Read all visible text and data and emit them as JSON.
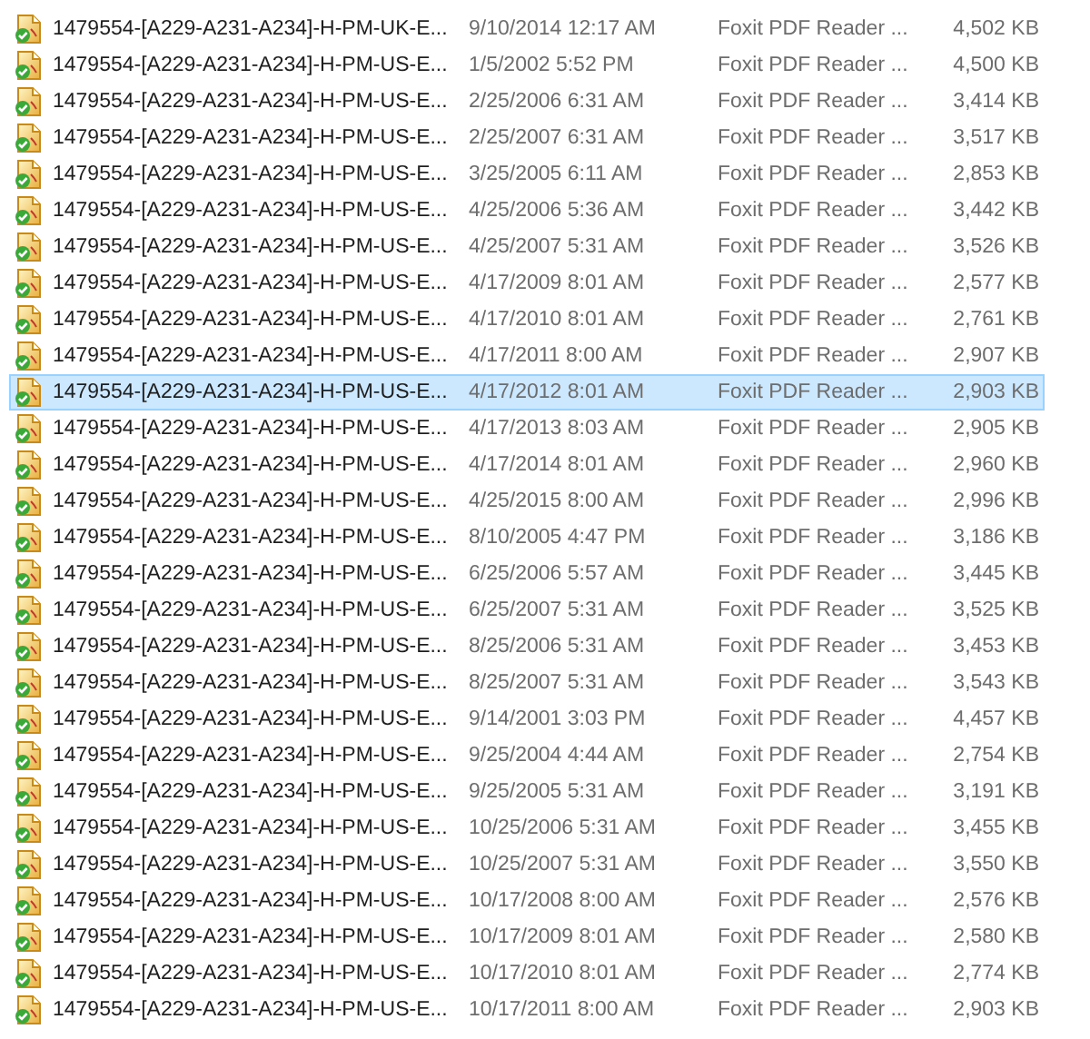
{
  "files": [
    {
      "name": "1479554-[A229-A231-A234]-H-PM-UK-E...",
      "modified": "9/10/2014 12:17 AM",
      "type": "Foxit PDF Reader ...",
      "size": "4,502 KB",
      "selected": false
    },
    {
      "name": "1479554-[A229-A231-A234]-H-PM-US-E...",
      "modified": "1/5/2002 5:52 PM",
      "type": "Foxit PDF Reader ...",
      "size": "4,500 KB",
      "selected": false
    },
    {
      "name": "1479554-[A229-A231-A234]-H-PM-US-E...",
      "modified": "2/25/2006 6:31 AM",
      "type": "Foxit PDF Reader ...",
      "size": "3,414 KB",
      "selected": false
    },
    {
      "name": "1479554-[A229-A231-A234]-H-PM-US-E...",
      "modified": "2/25/2007 6:31 AM",
      "type": "Foxit PDF Reader ...",
      "size": "3,517 KB",
      "selected": false
    },
    {
      "name": "1479554-[A229-A231-A234]-H-PM-US-E...",
      "modified": "3/25/2005 6:11 AM",
      "type": "Foxit PDF Reader ...",
      "size": "2,853 KB",
      "selected": false
    },
    {
      "name": "1479554-[A229-A231-A234]-H-PM-US-E...",
      "modified": "4/25/2006 5:36 AM",
      "type": "Foxit PDF Reader ...",
      "size": "3,442 KB",
      "selected": false
    },
    {
      "name": "1479554-[A229-A231-A234]-H-PM-US-E...",
      "modified": "4/25/2007 5:31 AM",
      "type": "Foxit PDF Reader ...",
      "size": "3,526 KB",
      "selected": false
    },
    {
      "name": "1479554-[A229-A231-A234]-H-PM-US-E...",
      "modified": "4/17/2009 8:01 AM",
      "type": "Foxit PDF Reader ...",
      "size": "2,577 KB",
      "selected": false
    },
    {
      "name": "1479554-[A229-A231-A234]-H-PM-US-E...",
      "modified": "4/17/2010 8:01 AM",
      "type": "Foxit PDF Reader ...",
      "size": "2,761 KB",
      "selected": false
    },
    {
      "name": "1479554-[A229-A231-A234]-H-PM-US-E...",
      "modified": "4/17/2011 8:00 AM",
      "type": "Foxit PDF Reader ...",
      "size": "2,907 KB",
      "selected": false
    },
    {
      "name": "1479554-[A229-A231-A234]-H-PM-US-E...",
      "modified": "4/17/2012 8:01 AM",
      "type": "Foxit PDF Reader ...",
      "size": "2,903 KB",
      "selected": true
    },
    {
      "name": "1479554-[A229-A231-A234]-H-PM-US-E...",
      "modified": "4/17/2013 8:03 AM",
      "type": "Foxit PDF Reader ...",
      "size": "2,905 KB",
      "selected": false
    },
    {
      "name": "1479554-[A229-A231-A234]-H-PM-US-E...",
      "modified": "4/17/2014 8:01 AM",
      "type": "Foxit PDF Reader ...",
      "size": "2,960 KB",
      "selected": false
    },
    {
      "name": "1479554-[A229-A231-A234]-H-PM-US-E...",
      "modified": "4/25/2015 8:00 AM",
      "type": "Foxit PDF Reader ...",
      "size": "2,996 KB",
      "selected": false
    },
    {
      "name": "1479554-[A229-A231-A234]-H-PM-US-E...",
      "modified": "8/10/2005 4:47 PM",
      "type": "Foxit PDF Reader ...",
      "size": "3,186 KB",
      "selected": false
    },
    {
      "name": "1479554-[A229-A231-A234]-H-PM-US-E...",
      "modified": "6/25/2006 5:57 AM",
      "type": "Foxit PDF Reader ...",
      "size": "3,445 KB",
      "selected": false
    },
    {
      "name": "1479554-[A229-A231-A234]-H-PM-US-E...",
      "modified": "6/25/2007 5:31 AM",
      "type": "Foxit PDF Reader ...",
      "size": "3,525 KB",
      "selected": false
    },
    {
      "name": "1479554-[A229-A231-A234]-H-PM-US-E...",
      "modified": "8/25/2006 5:31 AM",
      "type": "Foxit PDF Reader ...",
      "size": "3,453 KB",
      "selected": false
    },
    {
      "name": "1479554-[A229-A231-A234]-H-PM-US-E...",
      "modified": "8/25/2007 5:31 AM",
      "type": "Foxit PDF Reader ...",
      "size": "3,543 KB",
      "selected": false
    },
    {
      "name": "1479554-[A229-A231-A234]-H-PM-US-E...",
      "modified": "9/14/2001 3:03 PM",
      "type": "Foxit PDF Reader ...",
      "size": "4,457 KB",
      "selected": false
    },
    {
      "name": "1479554-[A229-A231-A234]-H-PM-US-E...",
      "modified": "9/25/2004 4:44 AM",
      "type": "Foxit PDF Reader ...",
      "size": "2,754 KB",
      "selected": false
    },
    {
      "name": "1479554-[A229-A231-A234]-H-PM-US-E...",
      "modified": "9/25/2005 5:31 AM",
      "type": "Foxit PDF Reader ...",
      "size": "3,191 KB",
      "selected": false
    },
    {
      "name": "1479554-[A229-A231-A234]-H-PM-US-E...",
      "modified": "10/25/2006 5:31 AM",
      "type": "Foxit PDF Reader ...",
      "size": "3,455 KB",
      "selected": false
    },
    {
      "name": "1479554-[A229-A231-A234]-H-PM-US-E...",
      "modified": "10/25/2007 5:31 AM",
      "type": "Foxit PDF Reader ...",
      "size": "3,550 KB",
      "selected": false
    },
    {
      "name": "1479554-[A229-A231-A234]-H-PM-US-E...",
      "modified": "10/17/2008 8:00 AM",
      "type": "Foxit PDF Reader ...",
      "size": "2,576 KB",
      "selected": false
    },
    {
      "name": "1479554-[A229-A231-A234]-H-PM-US-E...",
      "modified": "10/17/2009 8:01 AM",
      "type": "Foxit PDF Reader ...",
      "size": "2,580 KB",
      "selected": false
    },
    {
      "name": "1479554-[A229-A231-A234]-H-PM-US-E...",
      "modified": "10/17/2010 8:01 AM",
      "type": "Foxit PDF Reader ...",
      "size": "2,774 KB",
      "selected": false
    },
    {
      "name": "1479554-[A229-A231-A234]-H-PM-US-E...",
      "modified": "10/17/2011 8:00 AM",
      "type": "Foxit PDF Reader ...",
      "size": "2,903 KB",
      "selected": false
    }
  ]
}
